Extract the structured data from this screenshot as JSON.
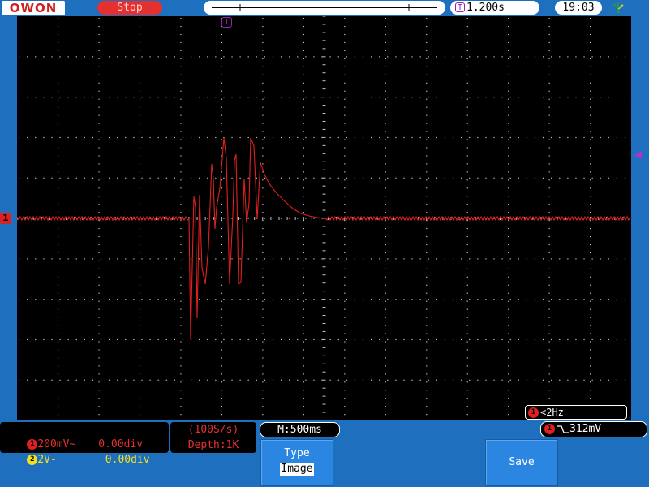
{
  "header": {
    "logo": "OWON",
    "run_state": "Stop",
    "timebase_marker": "T",
    "trigger_position_marker": "T",
    "horizontal_position": "1.200s",
    "clock": "19:03",
    "usb_icon": "usb-icon"
  },
  "screen": {
    "ch1_marker": "1",
    "trigger_level_marker_icon": "triangle-left-icon",
    "trigger_position_icon": "triangle-down-icon",
    "freq_channel": "1",
    "freq_readout": "<2Hz",
    "grid_color": "#c8c8c8",
    "trace_color": "#e02020"
  },
  "bottom": {
    "ch1": {
      "badge": "1",
      "scale": "200mV~",
      "offset": "0.00div"
    },
    "ch2": {
      "badge": "2",
      "scale": "2V-",
      "offset": "0.00div"
    },
    "acquisition": {
      "sample_rate": "(100S/s)",
      "depth": "Depth:1K"
    },
    "timebase": "M:500ms",
    "trigger": {
      "channel": "1",
      "level": "312mV",
      "edge_icon": "falling-edge-icon"
    },
    "softkeys": {
      "type_label": "Type",
      "type_value": "Image",
      "save_label": "Save"
    }
  },
  "colors": {
    "frame_blue": "#1f6fbf",
    "ch1_red": "#e53030",
    "ch2_yellow": "#f0e020",
    "marker_purple": "#9a1fb0"
  }
}
